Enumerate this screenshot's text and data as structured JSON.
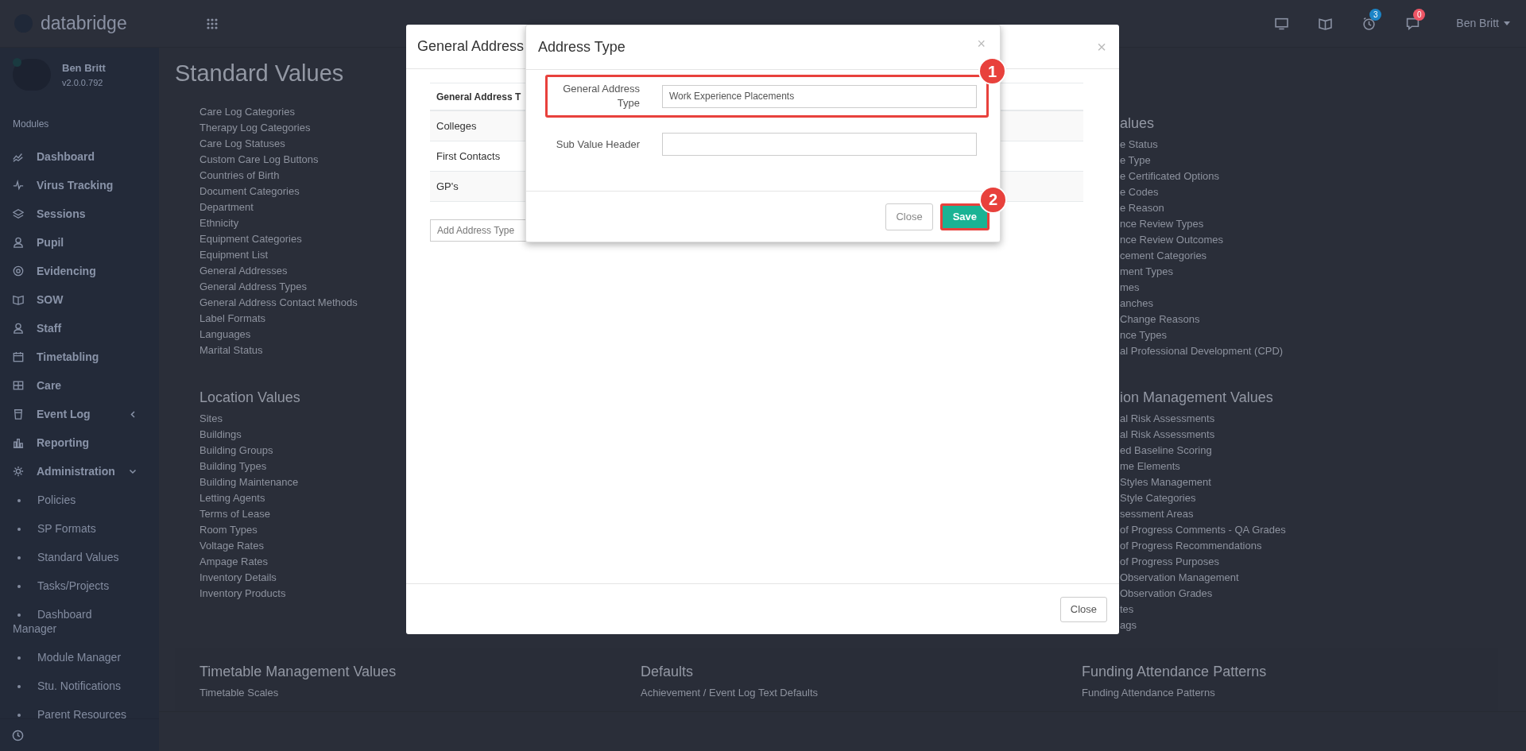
{
  "top_bar": {
    "logo": "databridge",
    "user_name": "Ben Britt",
    "icons": [
      {
        "kind": "monitor"
      },
      {
        "kind": "book"
      },
      {
        "kind": "clock",
        "badge": "3",
        "color": "#1c84c6"
      },
      {
        "kind": "chat",
        "badge": "0",
        "color": "#ed5565"
      }
    ]
  },
  "sidebar": {
    "user": {
      "name": "Ben Britt",
      "version": "v2.0.0.792"
    },
    "section_label": "Modules",
    "items": [
      {
        "label": "Dashboard",
        "kind": "chart"
      },
      {
        "label": "Virus Tracking",
        "kind": "pulse"
      },
      {
        "label": "Sessions",
        "kind": "layers"
      },
      {
        "label": "Pupil",
        "kind": "person"
      },
      {
        "label": "Evidencing",
        "kind": "camera"
      },
      {
        "label": "SOW",
        "kind": "book"
      },
      {
        "label": "Staff",
        "kind": "person"
      },
      {
        "label": "Timetabling",
        "kind": "calendar"
      },
      {
        "label": "Care",
        "kind": "grid"
      },
      {
        "label": "Event Log",
        "kind": "cup",
        "expanded": false
      },
      {
        "label": "Reporting",
        "kind": "bars"
      },
      {
        "label": "Administration",
        "kind": "gear",
        "expanded": true,
        "children": [
          {
            "label": "Policies"
          },
          {
            "label": "SP Formats"
          },
          {
            "label": "Standard Values"
          },
          {
            "label": "Tasks/Projects"
          },
          {
            "label": "Dashboard Manager"
          },
          {
            "label": "Module Manager"
          },
          {
            "label": "Stu. Notifications"
          },
          {
            "label": "Parent Resources"
          }
        ]
      }
    ]
  },
  "page": {
    "title": "Standard Values",
    "rows": [
      {
        "left": {
          "items": [
            "Care Log Categories",
            "Therapy Log Categories",
            "Care Log Statuses",
            "Custom Care Log Buttons",
            "Countries of Birth",
            "Document Categories",
            "Department",
            "Ethnicity",
            "Equipment Categories",
            "Equipment List",
            "General Addresses",
            "General Address Types",
            "General Address Contact Methods",
            "Label Formats",
            "Languages",
            "Marital Status"
          ]
        },
        "right": {
          "heading": "alues",
          "items": [
            "e Status",
            "e Type",
            "e Certificated Options",
            "e Codes",
            "e Reason",
            "nce Review Types",
            "nce Review Outcomes",
            "cement Categories",
            "ment Types",
            "mes",
            "anches",
            "Change Reasons",
            "nce Types",
            "al Professional Development (CPD)"
          ]
        }
      },
      {
        "left": {
          "heading": "Location Values",
          "items": [
            "Sites",
            "Buildings",
            "Building Groups",
            "Building Types",
            "Building Maintenance",
            "Letting Agents",
            "Terms of Lease",
            "Room Types",
            "Voltage Rates",
            "Ampage Rates",
            "Inventory Details",
            "Inventory Products"
          ]
        },
        "right": {
          "heading": "ion Management Values",
          "items": [
            "al Risk Assessments",
            "al Risk Assessments",
            "ed Baseline Scoring",
            "me Elements",
            "Styles Management",
            "Style Categories",
            "sessment Areas",
            "of Progress Comments - QA Grades",
            "of Progress Recommendations",
            "of Progress Purposes",
            "Observation Management",
            "Observation Grades",
            "tes",
            "ags"
          ]
        }
      },
      {
        "left": {
          "heading": "Timetable Management Values",
          "items": [
            "Timetable Scales"
          ]
        },
        "center": {
          "heading": "Defaults",
          "items": [
            "Achievement / Event Log Text Defaults"
          ]
        },
        "right": {
          "heading": "Funding Attendance Patterns",
          "items": [
            "Funding Attendance Patterns"
          ]
        }
      }
    ]
  },
  "outer_dialog": {
    "title": "General Address",
    "close_glyph": "×",
    "table": {
      "column": "General Address T",
      "rows": [
        "Colleges",
        "First Contacts",
        "GP's"
      ]
    },
    "add_field": {
      "placeholder": "Add Address Type"
    },
    "button": "Close"
  },
  "dialog": {
    "title": "Address Type",
    "close_glyph": "×",
    "fields": [
      {
        "label": "General Address Type",
        "value": "Work Experience Placements",
        "annotation": "1"
      },
      {
        "label": "Sub Value Header"
      }
    ],
    "buttons": [
      {
        "label": "Close",
        "kind": "default"
      },
      {
        "label": "Save",
        "kind": "primary",
        "annotation": "2"
      }
    ]
  }
}
